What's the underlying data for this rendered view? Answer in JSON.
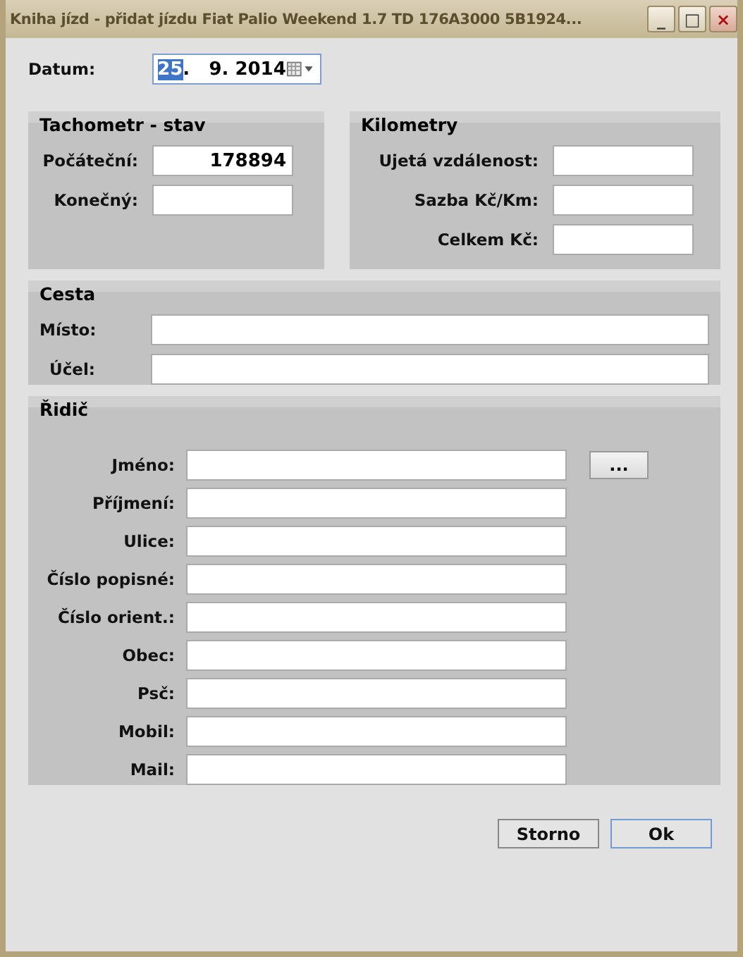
{
  "window": {
    "title": "Kniha jízd - přidat jízdu Fiat  Palio Weekend 1.7 TD 176A3000 5B1924...",
    "controls": [
      "_",
      "□",
      "×"
    ]
  },
  "date": {
    "label": "Datum:",
    "day": "25",
    "rest": ".   9. 2014"
  },
  "odometer": {
    "title": "Tachometr - stav",
    "fields": [
      {
        "label": "Počáteční:",
        "value": "178894"
      },
      {
        "label": "Konečný:"
      }
    ]
  },
  "kilometers": {
    "title": "Kilometry",
    "fields": [
      {
        "label": "Ujetá vzdálenost:"
      },
      {
        "label": "Sazba Kč/Km:"
      },
      {
        "label": "Celkem Kč:"
      }
    ]
  },
  "trip": {
    "title": "Cesta",
    "fields": [
      {
        "label": "Místo:"
      },
      {
        "label": "Účel:"
      }
    ]
  },
  "driver": {
    "title": "Řidič",
    "browse": "...",
    "fields": [
      {
        "label": "Jméno:"
      },
      {
        "label": "Příjmení:"
      },
      {
        "label": "Ulice:"
      },
      {
        "label": "Číslo popisné:"
      },
      {
        "label": "Číslo orient.:"
      },
      {
        "label": "Obec:"
      },
      {
        "label": "Psč:"
      },
      {
        "label": "Mobil:"
      },
      {
        "label": "Mail:"
      }
    ]
  },
  "buttons": [
    {
      "label": "Storno",
      "selected": false
    },
    {
      "label": "Ok",
      "selected": true
    }
  ]
}
